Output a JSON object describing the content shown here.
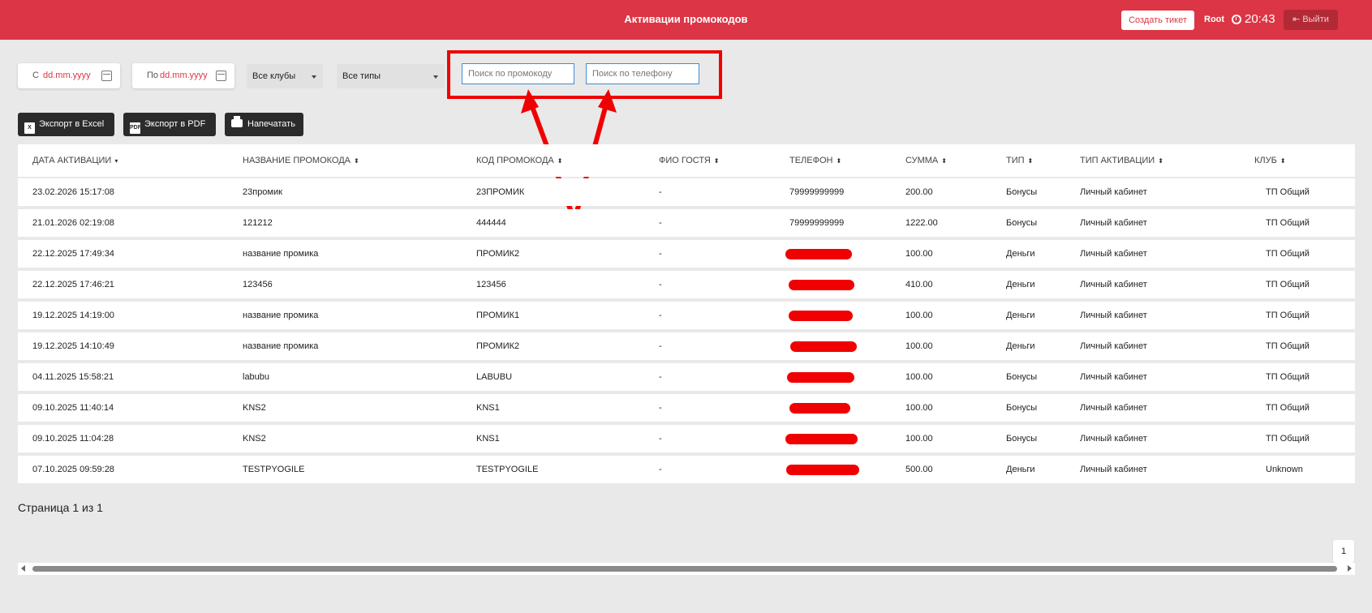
{
  "header": {
    "title": "Активации промокодов",
    "create_ticket": "Создать тикет",
    "user": "Root",
    "time": "20:43",
    "logout": "Выйти",
    "accent_color": "#dc3545"
  },
  "filters": {
    "from_label": "С",
    "to_label": "По",
    "date_placeholder": "dd.mm.yyyy",
    "clubs": "Все клубы",
    "types": "Все типы",
    "promo_search_placeholder": "Поиск по промокоду",
    "phone_search_placeholder": "Поиск по телефону"
  },
  "actions": {
    "excel": "Экспорт в Excel",
    "pdf": "Экспорт в PDF",
    "print": "Напечатать"
  },
  "table": {
    "columns": [
      "ДАТА АКТИВАЦИИ",
      "НАЗВАНИЕ ПРОМОКОДА",
      "КОД ПРОМОКОДА",
      "ФИО ГОСТЯ",
      "ТЕЛЕФОН",
      "СУММА",
      "ТИП",
      "ТИП АКТИВАЦИИ",
      "КЛУБ"
    ],
    "rows": [
      {
        "date": "23.02.2026 15:17:08",
        "name": "23промик",
        "code": "23ПРОМИК",
        "guest": "-",
        "phone": "79999999999",
        "sum": "200.00",
        "type": "Бонусы",
        "activation": "Личный кабинет",
        "club": "ТП Общий"
      },
      {
        "date": "21.01.2026 02:19:08",
        "name": "121212",
        "code": "444444",
        "guest": "-",
        "phone": "79999999999",
        "sum": "1222.00",
        "type": "Бонусы",
        "activation": "Личный кабинет",
        "club": "ТП Общий"
      },
      {
        "date": "22.12.2025 17:49:34",
        "name": "название промика",
        "code": "ПРОМИК2",
        "guest": "-",
        "phone": "",
        "sum": "100.00",
        "type": "Деньги",
        "activation": "Личный кабинет",
        "club": "ТП Общий"
      },
      {
        "date": "22.12.2025 17:46:21",
        "name": "123456",
        "code": "123456",
        "guest": "-",
        "phone": "",
        "sum": "410.00",
        "type": "Деньги",
        "activation": "Личный кабинет",
        "club": "ТП Общий"
      },
      {
        "date": "19.12.2025 14:19:00",
        "name": "название промика",
        "code": "ПРОМИК1",
        "guest": "-",
        "phone": "",
        "sum": "100.00",
        "type": "Деньги",
        "activation": "Личный кабинет",
        "club": "ТП Общий"
      },
      {
        "date": "19.12.2025 14:10:49",
        "name": "название промика",
        "code": "ПРОМИК2",
        "guest": "-",
        "phone": "",
        "sum": "100.00",
        "type": "Деньги",
        "activation": "Личный кабинет",
        "club": "ТП Общий"
      },
      {
        "date": "04.11.2025 15:58:21",
        "name": "labubu",
        "code": "LABUBU",
        "guest": "-",
        "phone": "",
        "sum": "100.00",
        "type": "Бонусы",
        "activation": "Личный кабинет",
        "club": "ТП Общий"
      },
      {
        "date": "09.10.2025 11:40:14",
        "name": "KNS2",
        "code": "KNS1",
        "guest": "-",
        "phone": "",
        "sum": "100.00",
        "type": "Бонусы",
        "activation": "Личный кабинет",
        "club": "ТП Общий"
      },
      {
        "date": "09.10.2025 11:04:28",
        "name": "KNS2",
        "code": "KNS1",
        "guest": "-",
        "phone": "",
        "sum": "100.00",
        "type": "Бонусы",
        "activation": "Личный кабинет",
        "club": "ТП Общий"
      },
      {
        "date": "07.10.2025 09:59:28",
        "name": "TESTPYOGILE",
        "code": "TESTPYOGILE",
        "guest": "-",
        "phone": "",
        "sum": "500.00",
        "type": "Деньги",
        "activation": "Личный кабинет",
        "club": "Unknown"
      }
    ]
  },
  "pagination": {
    "info": "Страница 1 из 1",
    "current_page": "1"
  }
}
